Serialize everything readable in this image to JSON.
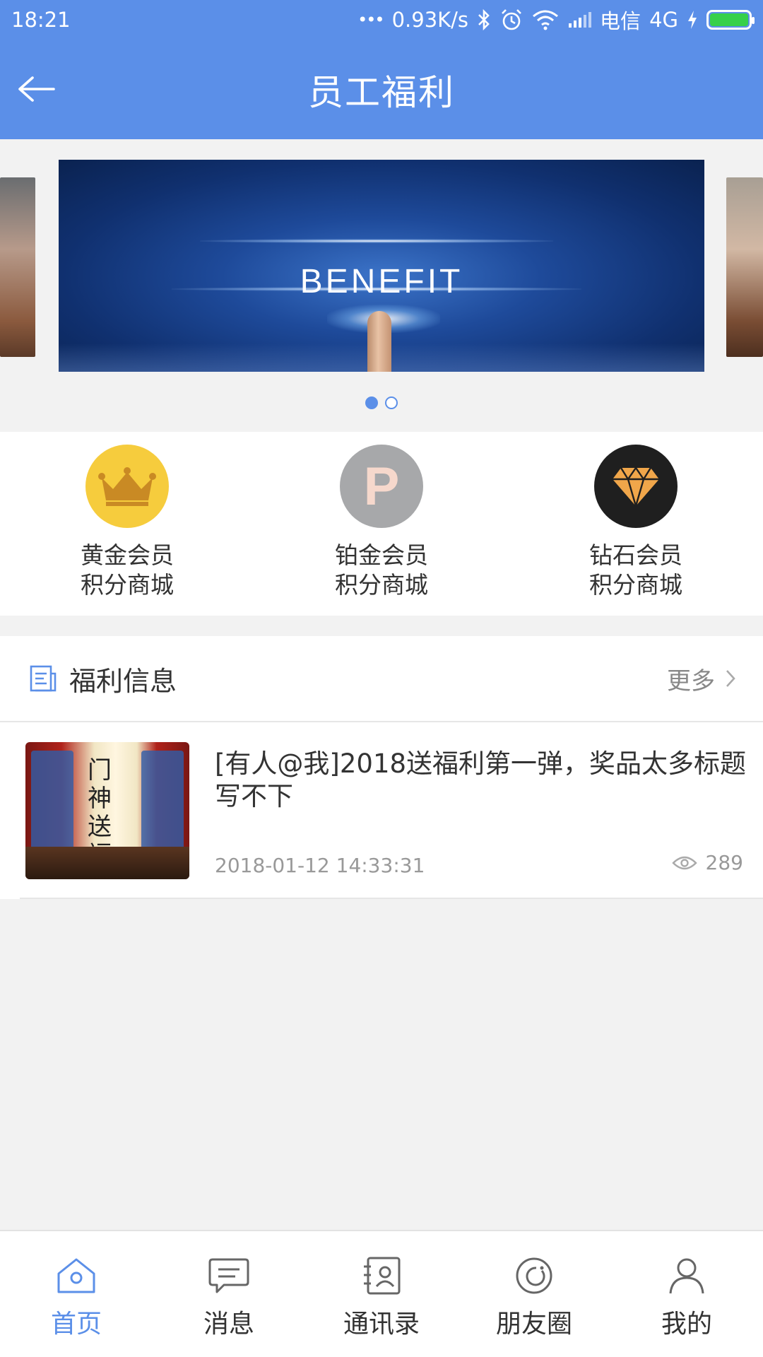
{
  "status_bar": {
    "time": "18:21",
    "dots": "•••",
    "net_speed": "0.93K/s",
    "carrier": "电信",
    "network": "4G",
    "icons": [
      "bluetooth-icon",
      "alarm-icon",
      "wifi-icon",
      "signal-icon",
      "charging-icon",
      "battery-icon"
    ],
    "battery_color": "#37d04b"
  },
  "header": {
    "title": "员工福利",
    "back_icon": "arrow-left-icon",
    "background": "#5b8fe8"
  },
  "banner": {
    "text": "BENEFIT",
    "slides": 2,
    "active_slide": 1
  },
  "memberships": [
    {
      "line1": "黄金会员",
      "line2": "积分商城",
      "icon": "crown-icon",
      "color": "#f6cc3d"
    },
    {
      "line1": "铂金会员",
      "line2": "积分商城",
      "icon": "p-letter-icon",
      "letter": "P",
      "color": "#a7a8aa"
    },
    {
      "line1": "钻石会员",
      "line2": "积分商城",
      "icon": "diamond-icon",
      "color": "#1f1f1f"
    }
  ],
  "info_section": {
    "title": "福利信息",
    "more_label": "更多",
    "items": [
      {
        "title": "[有人@我]2018送福利第一弹，奖品太多标题写不下",
        "thumb_text": "门神送福",
        "date": "2018-01-12 14:33:31",
        "views": "289"
      }
    ]
  },
  "tabbar": {
    "active_color": "#5b8fe8",
    "tabs": [
      {
        "label": "首页",
        "icon": "home-icon",
        "active": true
      },
      {
        "label": "消息",
        "icon": "message-icon",
        "active": false
      },
      {
        "label": "通讯录",
        "icon": "contacts-icon",
        "active": false
      },
      {
        "label": "朋友圈",
        "icon": "moments-icon",
        "active": false
      },
      {
        "label": "我的",
        "icon": "profile-icon",
        "active": false
      }
    ]
  }
}
